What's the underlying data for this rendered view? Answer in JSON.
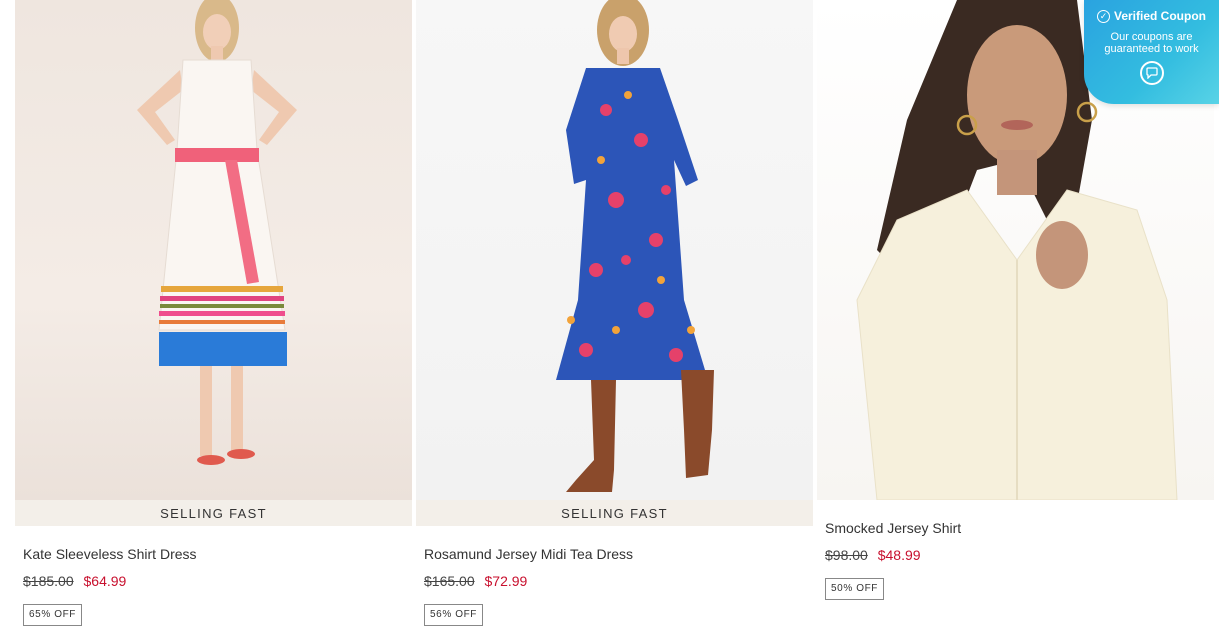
{
  "products": [
    {
      "badge": "SELLING FAST",
      "name": "Kate Sleeveless Shirt Dress",
      "was_price": "$185.00",
      "now_price": "$64.99",
      "discount": "65% OFF"
    },
    {
      "badge": "SELLING FAST",
      "name": "Rosamund Jersey Midi Tea Dress",
      "was_price": "$165.00",
      "now_price": "$72.99",
      "discount": "56% OFF"
    },
    {
      "name": "Smocked Jersey Shirt",
      "was_price": "$98.00",
      "now_price": "$48.99",
      "discount": "50% OFF"
    }
  ],
  "coupon": {
    "title": "Verified Coupon",
    "text": "Our coupons are guaranteed to work",
    "icon": "chat-icon"
  },
  "colors": {
    "sale_price": "#c8102e",
    "badge_bg": "#f3efe9",
    "coupon_bg": "#2aa3e0"
  }
}
